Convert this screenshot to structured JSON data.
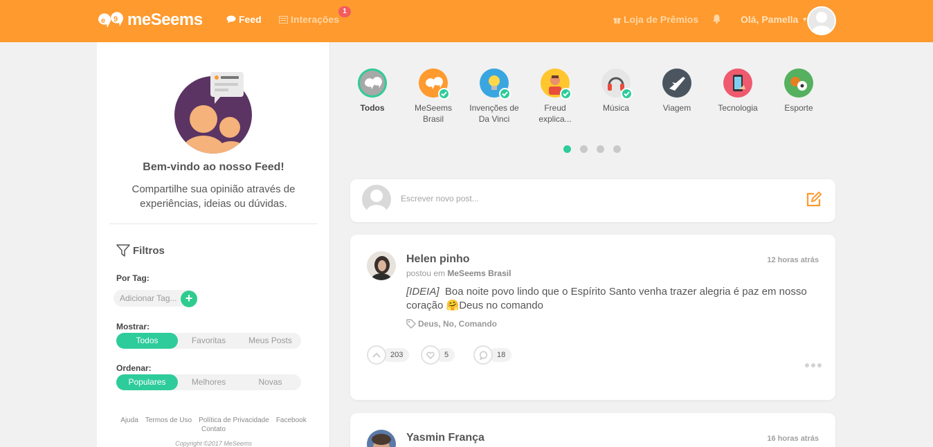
{
  "header": {
    "logo_text": "meSeems",
    "nav": {
      "feed": "Feed",
      "interacoes": "Interações",
      "interacoes_badge": "1"
    },
    "rewards": "Loja de Prêmios",
    "greeting": "Olá, Pamella"
  },
  "sidebar": {
    "welcome_title": "Bem-vindo ao nosso Feed!",
    "welcome_text": "Compartilhe sua opinião através de experiências, ideias ou dúvidas.",
    "filters_title": "Filtros",
    "tag_label": "Por Tag:",
    "tag_placeholder": "Adicionar Tag...",
    "show_label": "Mostrar:",
    "show_options": [
      "Todos",
      "Favoritas",
      "Meus Posts"
    ],
    "sort_label": "Ordenar:",
    "sort_options": [
      "Populares",
      "Melhores",
      "Novas"
    ],
    "footer_links": [
      "Ajuda",
      "Termos de Uso",
      "Política de Privacidade",
      "Facebook",
      "Contato"
    ],
    "copyright": "Copyright ©2017 MeSeems"
  },
  "categories": [
    {
      "label": "Todos",
      "icon": "meseems-logo-icon",
      "color": "#a8a8a8",
      "checked": false
    },
    {
      "label": "MeSeems Brasil",
      "icon": "meseems-logo-icon",
      "color": "#fe9a2e",
      "checked": true
    },
    {
      "label": "Invenções de Da Vinci",
      "icon": "lightbulb-icon",
      "color": "#3aa6e0",
      "checked": true
    },
    {
      "label": "Freud explica...",
      "icon": "person-icon",
      "color": "#ffc62e",
      "checked": true
    },
    {
      "label": "Música",
      "icon": "headphones-icon",
      "color": "#e6e6e6",
      "checked": true
    },
    {
      "label": "Viagem",
      "icon": "airplane-icon",
      "color": "#4a5560",
      "checked": false
    },
    {
      "label": "Tecnologia",
      "icon": "phone-icon",
      "color": "#ef5a6e",
      "checked": false
    },
    {
      "label": "Esporte",
      "icon": "balls-icon",
      "color": "#55b060",
      "checked": false
    }
  ],
  "composer": {
    "placeholder": "Escrever novo post..."
  },
  "posts": [
    {
      "author": "Helen pinho",
      "time": "12 horas atrás",
      "posted_prefix": "postou em",
      "group": "MeSeems Brasil",
      "tag_prefix": "[IDEIA]",
      "text": "Boa noite povo lindo que o Espírito Santo venha trazer alegria é paz em nosso coração 🤗Deus no comando",
      "tags": "Deus, No, Comando",
      "upvotes": "203",
      "likes": "5",
      "comments": "18"
    },
    {
      "author": "Yasmin França",
      "time": "16 horas atrás"
    }
  ]
}
